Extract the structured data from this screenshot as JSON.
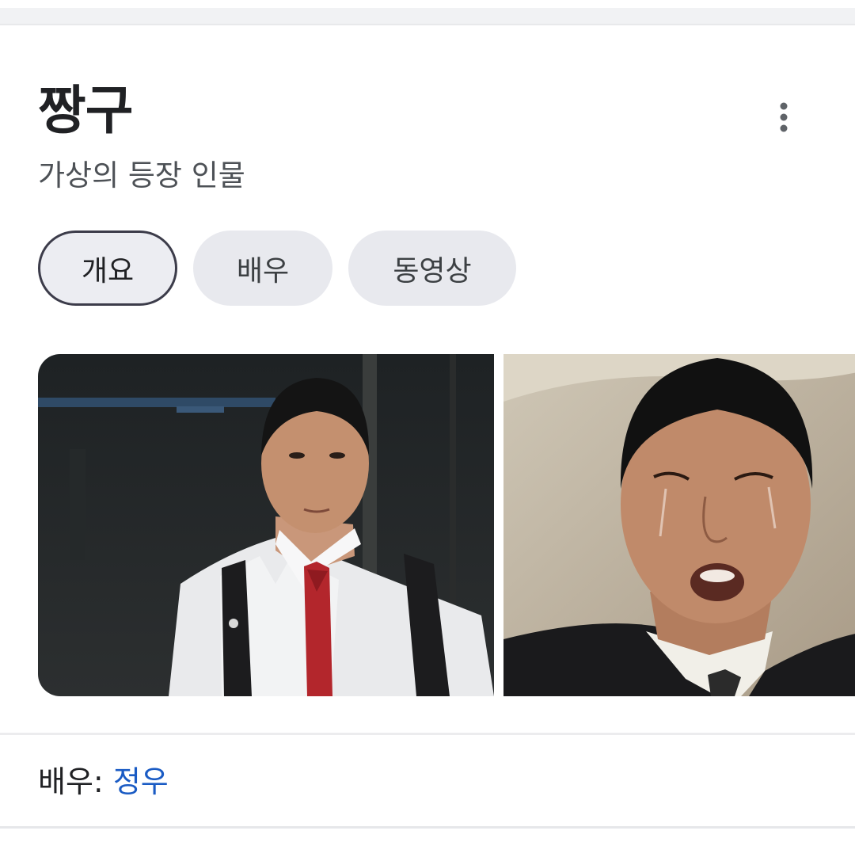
{
  "entity": {
    "title": "짱구",
    "subtitle": "가상의 등장 인물",
    "more_icon": "more-vertical-icon"
  },
  "tabs": [
    {
      "label": "개요",
      "selected": true
    },
    {
      "label": "배우",
      "selected": false
    },
    {
      "label": "동영상",
      "selected": false
    }
  ],
  "gallery": {
    "photo_1": "actor-photo-school-uniform",
    "photo_2": "actor-photo-crying"
  },
  "facts": {
    "actor_label": "배우:",
    "actor_value": "정우"
  },
  "colors": {
    "link": "#1a5bc4",
    "chip_bg": "#e8e9ee",
    "chip_selected_border": "#3c3c4a",
    "title_text": "#202124",
    "subtitle_text": "#4d5156"
  }
}
